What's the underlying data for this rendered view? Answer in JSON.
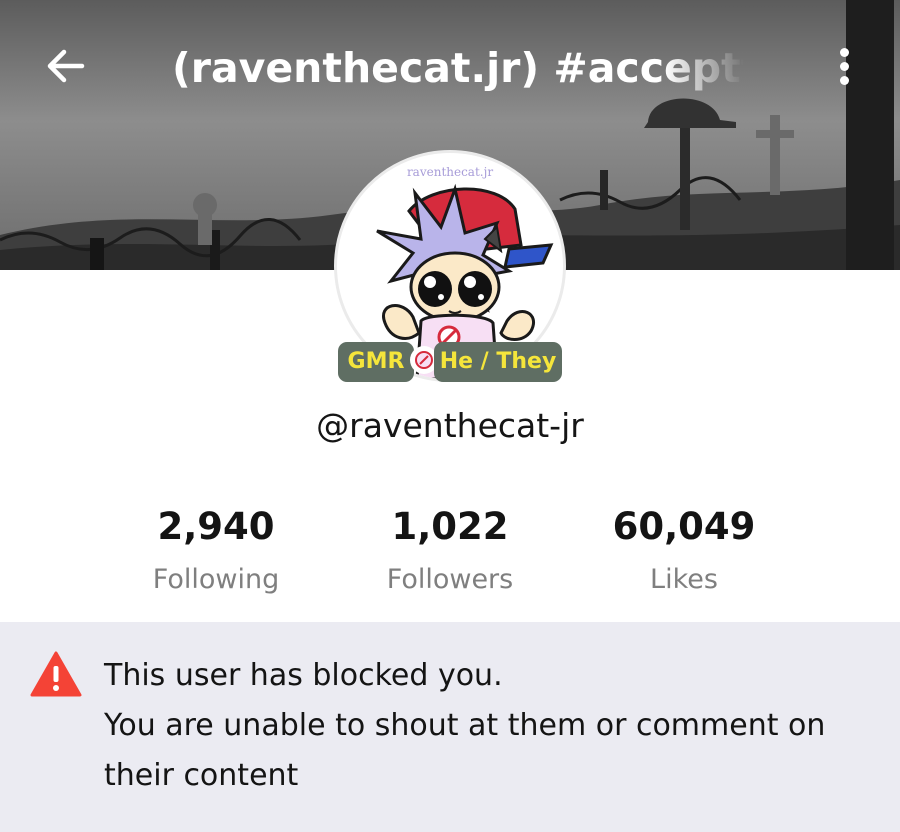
{
  "header": {
    "title": "(raventhecat.jr) #acceptthe",
    "back_icon": "arrow-left-icon",
    "menu_icon": "more-vertical-icon"
  },
  "profile": {
    "avatar_watermark": "raventhecat.jr",
    "tags": {
      "role": "GMR",
      "pronouns": "He / They"
    },
    "username": "@raventhecat-jr"
  },
  "stats": [
    {
      "value": "2,940",
      "label": "Following"
    },
    {
      "value": "1,022",
      "label": "Followers"
    },
    {
      "value": "60,049",
      "label": "Likes"
    }
  ],
  "notice": {
    "icon": "warning-triangle-icon",
    "line1": "This user has blocked you.",
    "line2": "You are unable to shout at them or comment on their content"
  },
  "colors": {
    "tag_background": "#5f6e63",
    "tag_text": "#f5e53b",
    "warning": "#f44336",
    "notice_background": "#ebebf2",
    "label_gray": "#7f7f7f"
  }
}
